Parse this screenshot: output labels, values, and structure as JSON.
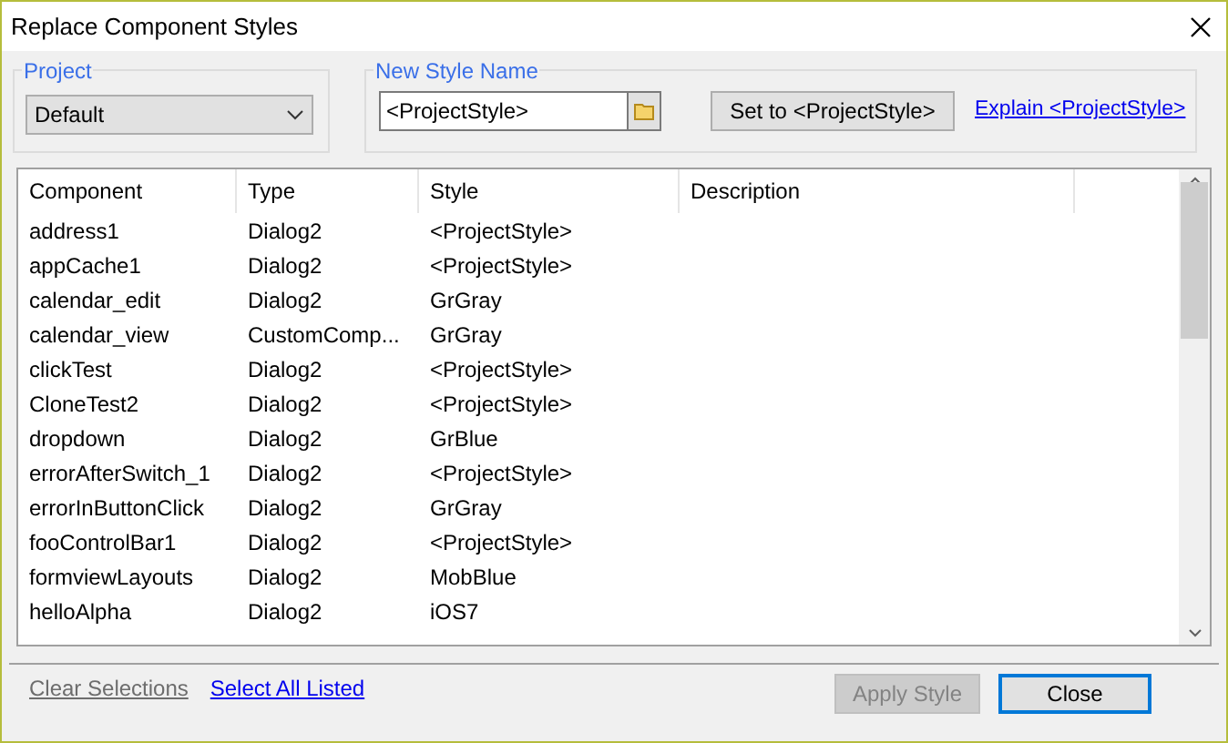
{
  "window": {
    "title": "Replace Component Styles"
  },
  "project": {
    "legend": "Project",
    "value": "Default"
  },
  "new_style": {
    "legend": "New Style Name",
    "value": "<ProjectStyle>",
    "set_button": "Set to <ProjectStyle>",
    "explain_link": "Explain <ProjectStyle>"
  },
  "table": {
    "columns": [
      "Component",
      "Type",
      "Style",
      "Description"
    ],
    "rows": [
      [
        "address1",
        "Dialog2",
        "<ProjectStyle>"
      ],
      [
        "appCache1",
        "Dialog2",
        "<ProjectStyle>"
      ],
      [
        "calendar_edit",
        "Dialog2",
        "GrGray"
      ],
      [
        "calendar_view",
        "CustomComp...",
        "GrGray"
      ],
      [
        "clickTest",
        "Dialog2",
        "<ProjectStyle>"
      ],
      [
        "CloneTest2",
        "Dialog2",
        "<ProjectStyle>"
      ],
      [
        "dropdown",
        "Dialog2",
        "GrBlue"
      ],
      [
        "errorAfterSwitch_1",
        "Dialog2",
        "<ProjectStyle>"
      ],
      [
        "errorInButtonClick",
        "Dialog2",
        "GrGray"
      ],
      [
        "fooControlBar1",
        "Dialog2",
        "<ProjectStyle>"
      ],
      [
        "formviewLayouts",
        "Dialog2",
        "MobBlue"
      ],
      [
        "helloAlpha",
        "Dialog2",
        "iOS7"
      ]
    ]
  },
  "links": [
    {
      "label": "Clear Selections",
      "disabled": true
    },
    {
      "label": "Select All Listed",
      "disabled": false
    }
  ],
  "buttons": [
    {
      "label": "Apply Style",
      "disabled": true,
      "default": false
    },
    {
      "label": "Close",
      "disabled": false,
      "default": true
    }
  ]
}
